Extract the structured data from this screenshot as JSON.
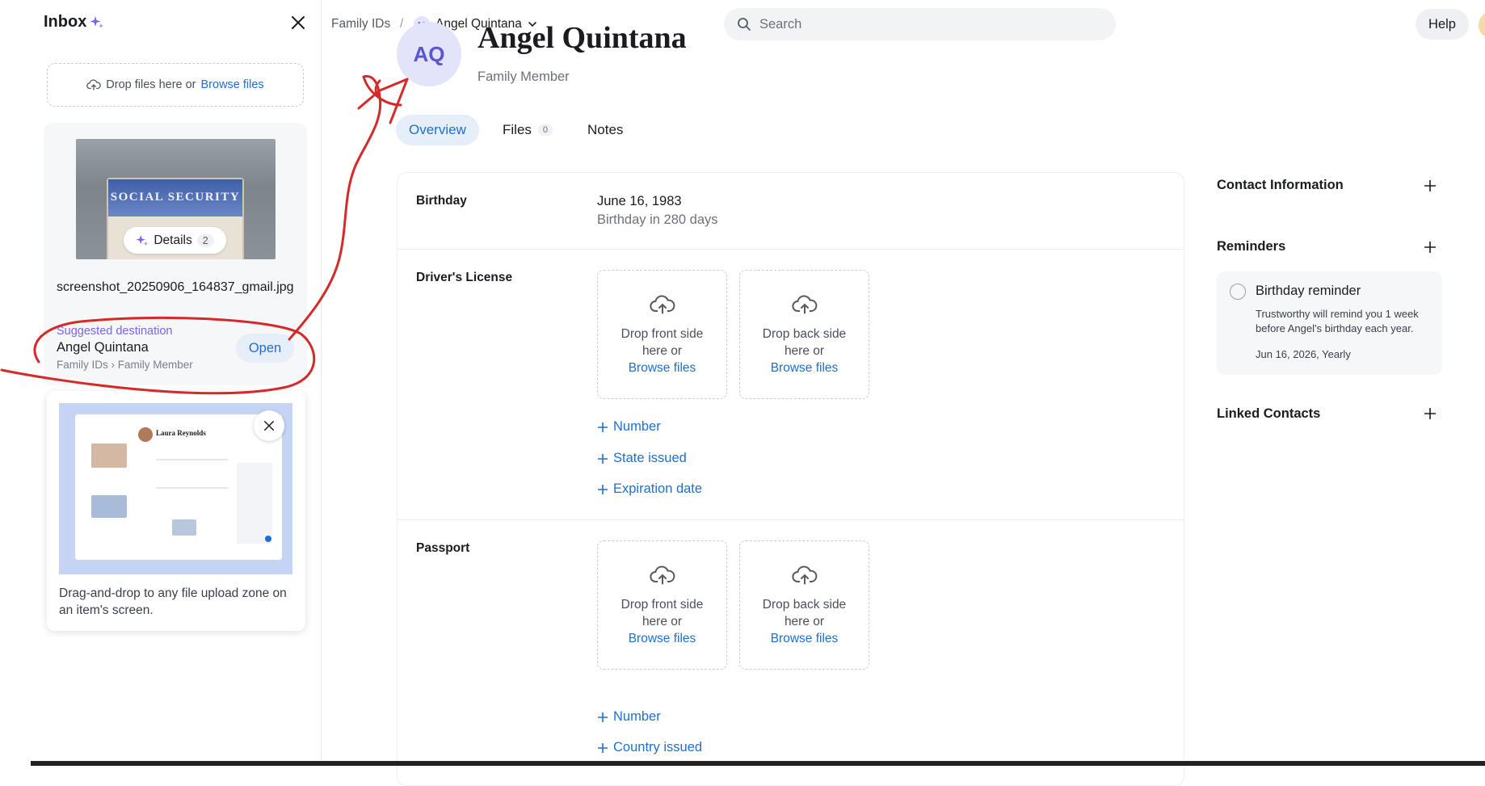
{
  "inbox": {
    "title": "Inbox",
    "dropzone": {
      "text": "Drop files here or",
      "link": "Browse files"
    },
    "file_card": {
      "thumbnail_text": "SOCIAL SECURITY",
      "details_label": "Details",
      "details_count": "2",
      "filename": "screenshot_20250906_164837_gmail.jpg",
      "suggested_label": "Suggested destination",
      "suggested_name": "Angel Quintana",
      "suggested_path": "Family IDs › Family Member",
      "open_label": "Open"
    },
    "tip": {
      "preview_name": "Laura Reynolds",
      "text": "Drag-and-drop to any file upload zone on an item's screen."
    }
  },
  "topbar": {
    "breadcrumb_root": "Family IDs",
    "breadcrumb_sep": "/",
    "breadcrumb_avatar": "AQ",
    "breadcrumb_current": "Angel Quintana",
    "search_placeholder": "Search",
    "help_label": "Help"
  },
  "header": {
    "avatar_initials": "AQ",
    "name": "Angel Quintana",
    "role": "Family Member"
  },
  "tabs": [
    {
      "label": "Overview",
      "active": true
    },
    {
      "label": "Files",
      "count": "0"
    },
    {
      "label": "Notes"
    }
  ],
  "main": {
    "birthday": {
      "label": "Birthday",
      "date": "June 16, 1983",
      "sub": "Birthday in 280 days"
    },
    "drivers_license": {
      "label": "Driver's License",
      "front": {
        "line1": "Drop front side",
        "line2": "here or",
        "link": "Browse files"
      },
      "back": {
        "line1": "Drop back side",
        "line2": "here or",
        "link": "Browse files"
      },
      "fields": [
        "Number",
        "State issued",
        "Expiration date"
      ]
    },
    "passport": {
      "label": "Passport",
      "front": {
        "line1": "Drop front side",
        "line2": "here or",
        "link": "Browse files"
      },
      "back": {
        "line1": "Drop back side",
        "line2": "here or",
        "link": "Browse files"
      },
      "fields": [
        "Number",
        "Country issued"
      ]
    }
  },
  "sidebar": {
    "contact_title": "Contact Information",
    "reminders_title": "Reminders",
    "reminder": {
      "title": "Birthday reminder",
      "desc": "Trustworthy will remind you 1 week before Angel's birthday each year.",
      "date": "Jun 16, 2026, Yearly"
    },
    "linked_title": "Linked Contacts"
  },
  "colors": {
    "accent": "#1f6fd1",
    "sparkle": "#7b61ff",
    "avatar_bg": "#e3e3fa",
    "annotation": "#d42a2a"
  },
  "icons": [
    "sparkle-icon",
    "close-icon",
    "upload-cloud-icon",
    "search-icon",
    "chevron-down-icon",
    "plus-icon",
    "radio-icon"
  ]
}
